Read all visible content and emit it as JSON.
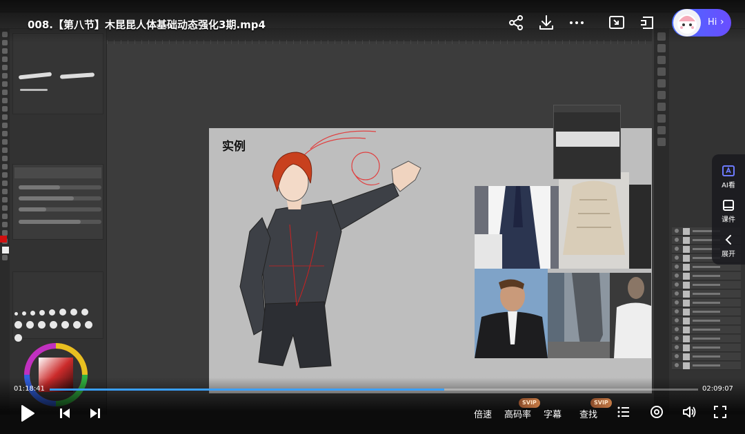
{
  "player": {
    "title": "008.【第八节】木昆昆人体基础动态强化3期.mp4",
    "time_current": "01:18:41",
    "time_total": "02:09:07",
    "progress": 0.609,
    "buffered": 0.36,
    "accent_color": "#3aa0ff",
    "top_icons": [
      "share-icon",
      "download-icon",
      "more-icon",
      "picture-in-picture-icon",
      "cast-icon"
    ],
    "assistant": {
      "label": "Hi"
    },
    "side_menu": [
      {
        "label": "AI看",
        "icon": "ai-view-icon"
      },
      {
        "label": "课件",
        "icon": "courseware-icon"
      },
      {
        "label": "展开",
        "icon": "chevron-left-icon"
      }
    ],
    "controls": {
      "speed": "倍速",
      "quality": "高码率",
      "subtitle": "字幕",
      "search": "查找",
      "svip_badge": "SVIP"
    }
  },
  "canvas": {
    "paper_title": "实例"
  }
}
